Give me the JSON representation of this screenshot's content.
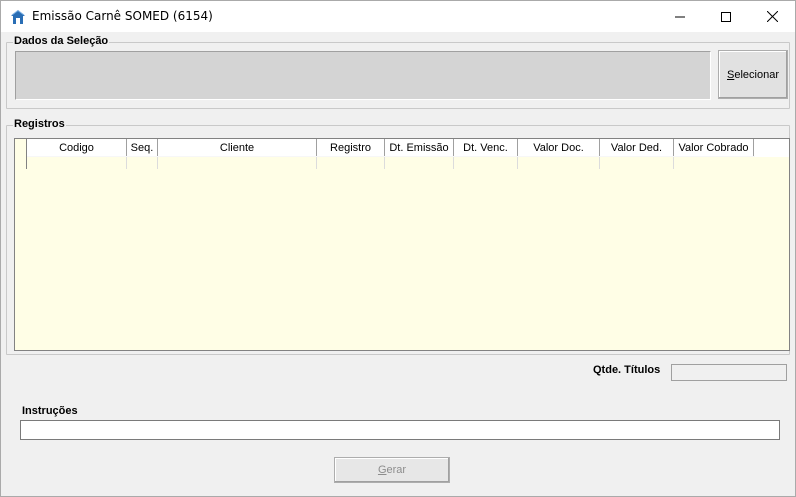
{
  "window": {
    "title": "Emissão Carnê SOMED (6154)",
    "icon": "app-house-icon"
  },
  "dados": {
    "label": "Dados da Seleção",
    "selecionar_prefix": "S",
    "selecionar_rest": "elecionar"
  },
  "registros": {
    "label": "Registros",
    "columns": [
      "Codigo",
      "Seq.",
      "Cliente",
      "Registro",
      "Dt. Emissão",
      "Dt. Venc.",
      "Valor Doc.",
      "Valor Ded.",
      "Valor Cobrado"
    ]
  },
  "qtde": {
    "label": "Qtde. Títulos",
    "value": ""
  },
  "instrucoes": {
    "label": "Instruções",
    "value": ""
  },
  "gerar": {
    "prefix": "G",
    "rest": "erar"
  },
  "colors": {
    "grid_bg": "#fffee6",
    "panel_bg": "#d4d4d4",
    "window_bg": "#f0f0f0"
  }
}
